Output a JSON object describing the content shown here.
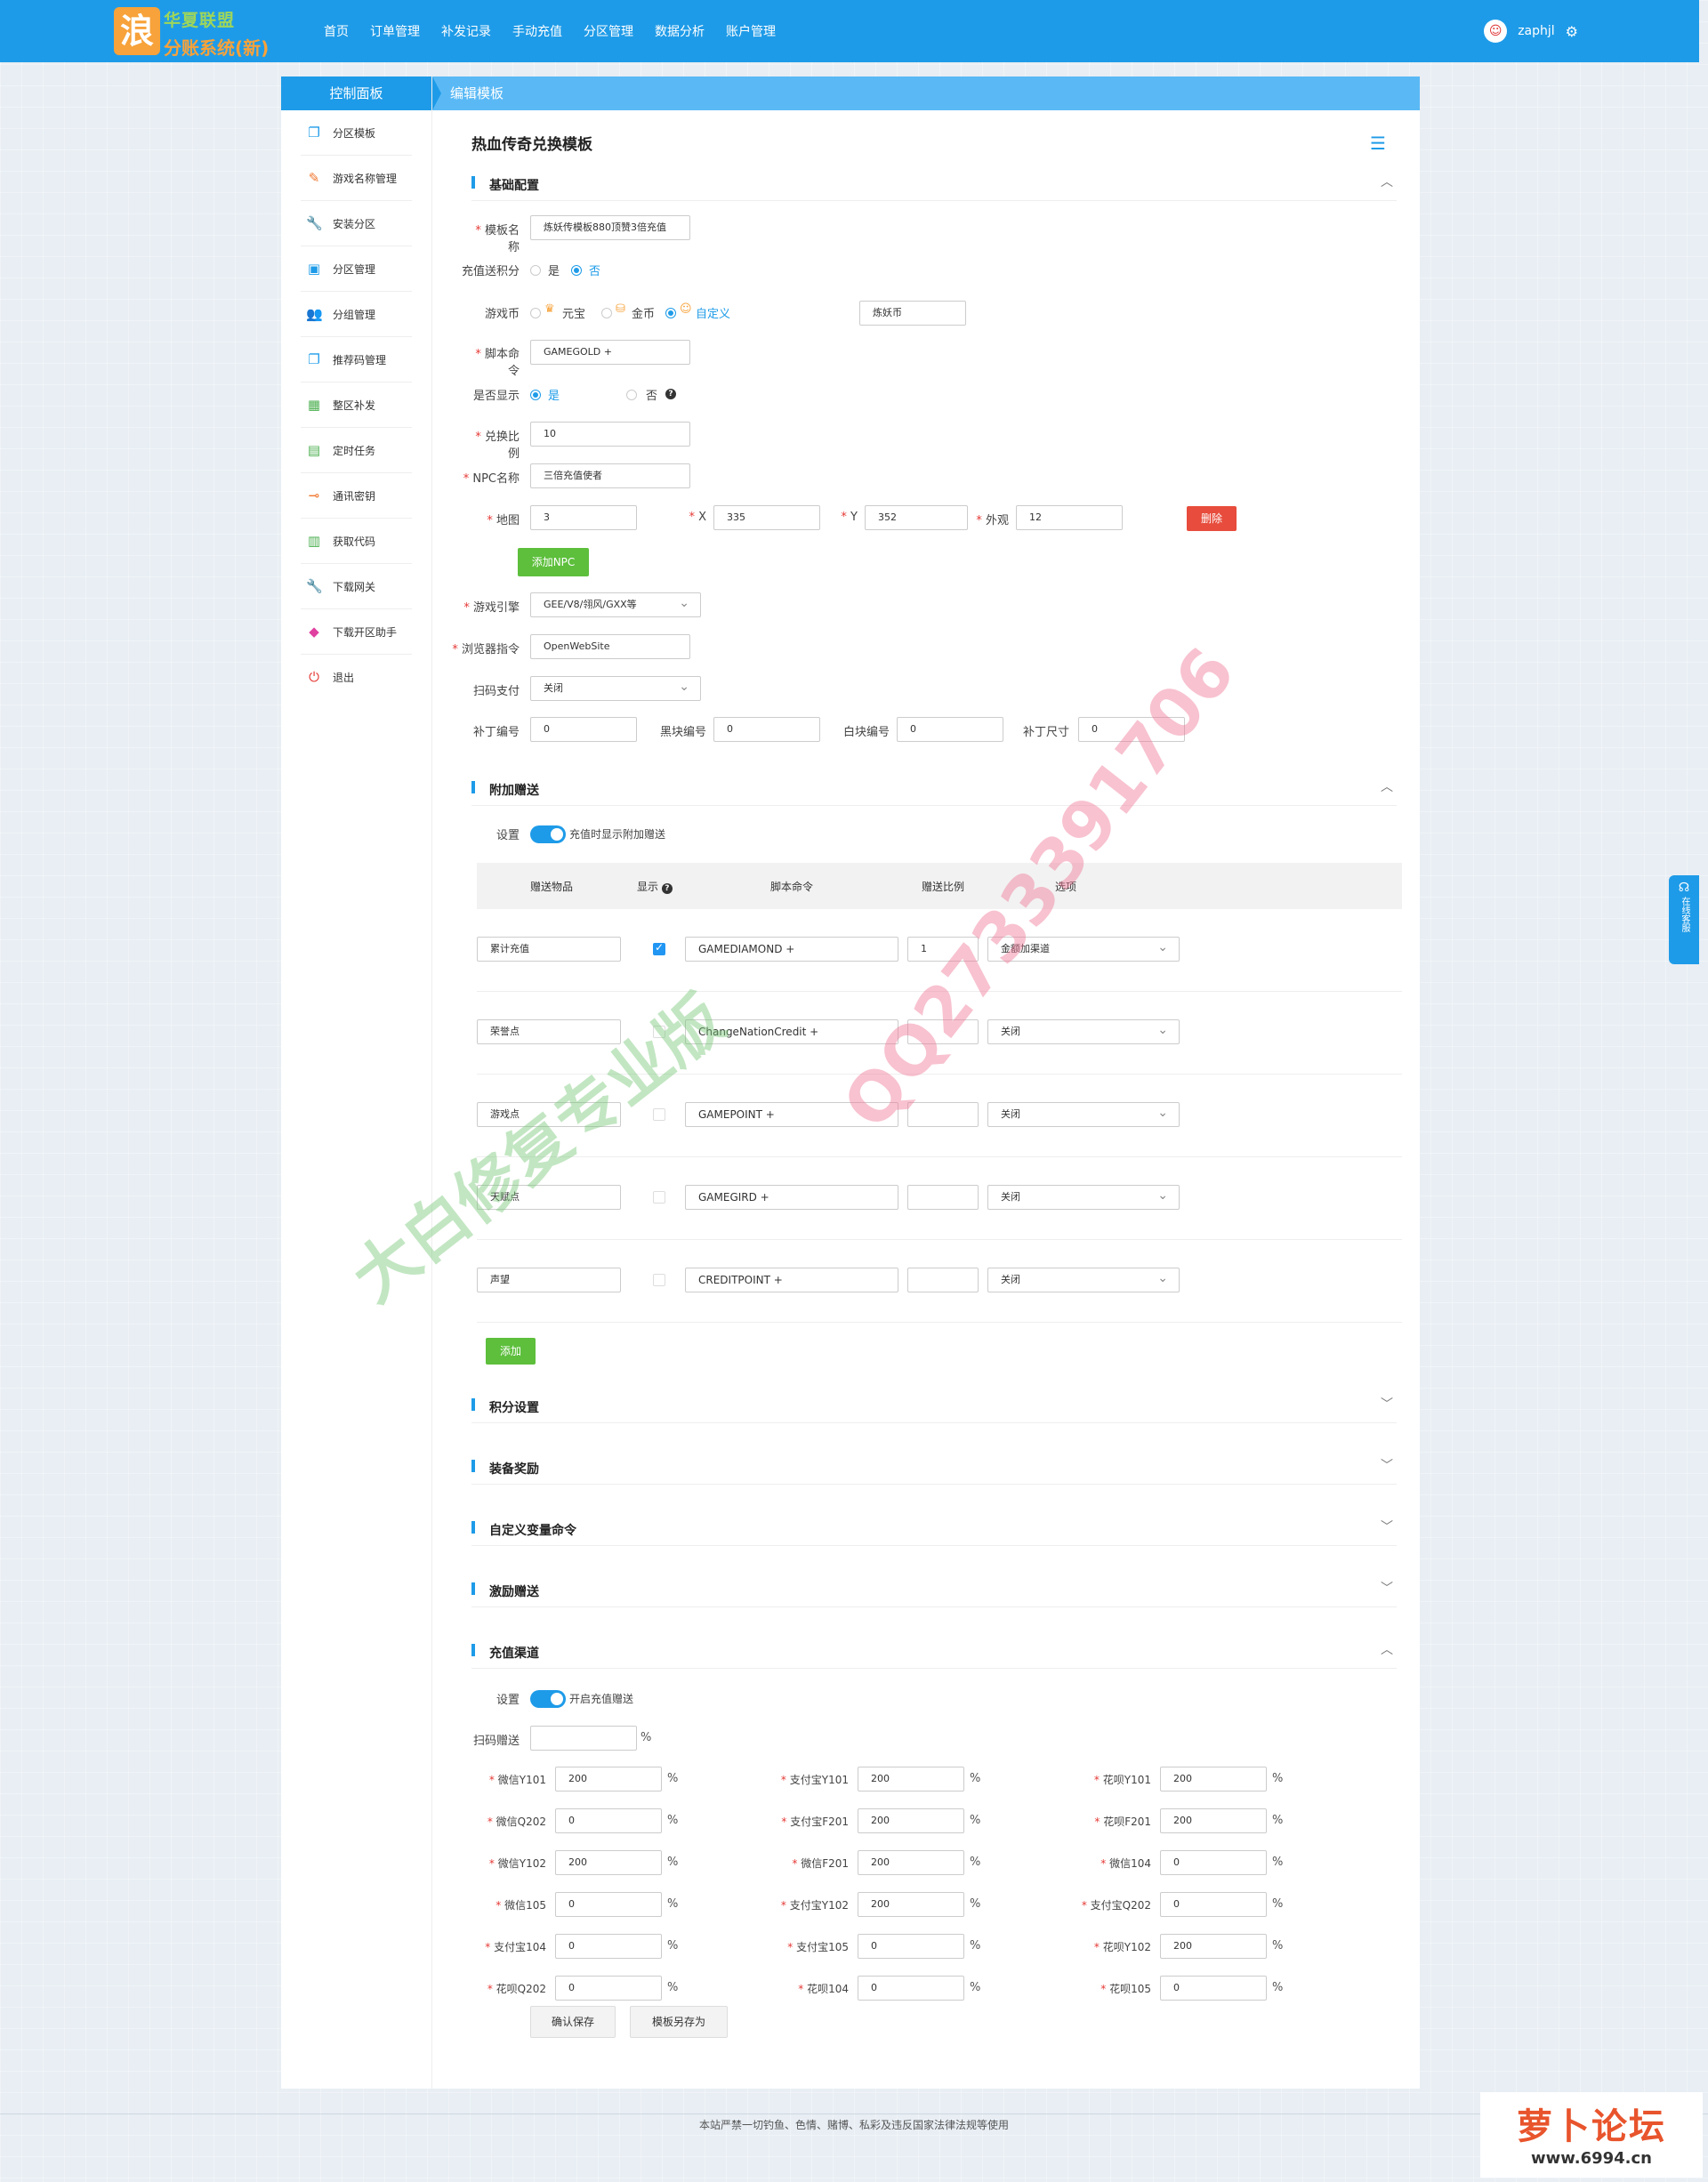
{
  "header": {
    "logo_glyph": "浪",
    "logo_sub": "华夏联盟",
    "logo_text": "分账系统(新)",
    "nav": [
      "首页",
      "订单管理",
      "补发记录",
      "手动充值",
      "分区管理",
      "数据分析",
      "账户管理"
    ],
    "username": "zaphjl"
  },
  "sidebar": {
    "title": "控制面板",
    "items": [
      {
        "label": "分区模板",
        "icon": "copy-icon"
      },
      {
        "label": "游戏名称管理",
        "icon": "pencil-icon"
      },
      {
        "label": "安装分区",
        "icon": "wrench-icon"
      },
      {
        "label": "分区管理",
        "icon": "inbox-icon"
      },
      {
        "label": "分组管理",
        "icon": "users-icon"
      },
      {
        "label": "推荐码管理",
        "icon": "copy-icon"
      },
      {
        "label": "整区补发",
        "icon": "suitcase-icon"
      },
      {
        "label": "定时任务",
        "icon": "calendar-icon"
      },
      {
        "label": "通讯密钥",
        "icon": "key-icon"
      },
      {
        "label": "获取代码",
        "icon": "briefcase-icon"
      },
      {
        "label": "下载网关",
        "icon": "wrench-icon"
      },
      {
        "label": "下载开区助手",
        "icon": "eraser-icon"
      },
      {
        "label": "退出",
        "icon": "power-icon"
      }
    ]
  },
  "breadcrumb": "编辑模板",
  "page_title": "热血传奇兑换模板",
  "basic": {
    "title": "基础配置",
    "template_name_label": "模板名称",
    "template_name": "炼妖传模板880顶赞3倍充值",
    "points_label": "充值送积分",
    "yes": "是",
    "no": "否",
    "currency_label": "游戏币",
    "currency_options": [
      "元宝",
      "金币",
      "自定义"
    ],
    "currency_custom": "炼妖币",
    "script_label": "脚本命令",
    "script": "GAMEGOLD +",
    "show_label": "是否显示",
    "ratio_label": "兑换比例",
    "ratio": "10",
    "npc_label": "NPC名称",
    "npc": "三倍充值使者",
    "map_label": "地图",
    "map": "3",
    "x_label": "X",
    "x": "335",
    "y_label": "Y",
    "y": "352",
    "look_label": "外观",
    "look": "12",
    "delete_btn": "删除",
    "add_npc_btn": "添加NPC",
    "engine_label": "游戏引擎",
    "engine": "GEE/V8/翎风/GXX等",
    "browser_label": "浏览器指令",
    "browser": "OpenWebSite",
    "scan_label": "扫码支付",
    "scan": "关闭",
    "patch_label": "补丁编号",
    "patch": "0",
    "black_label": "黑块编号",
    "black": "0",
    "white_label": "白块编号",
    "white": "0",
    "patch_size_label": "补丁尺寸",
    "patch_size": "0"
  },
  "bonus": {
    "title": "附加赠送",
    "setting_label": "设置",
    "toggle_text": "充值时显示附加赠送",
    "headers": [
      "赠送物品",
      "显示",
      "脚本命令",
      "赠送比例",
      "选项"
    ],
    "rows": [
      {
        "item": "累计充值",
        "checked": true,
        "script": "GAMEDIAMOND +",
        "ratio": "1",
        "option": "金额加渠道"
      },
      {
        "item": "荣誉点",
        "checked": false,
        "script": "ChangeNationCredit +",
        "ratio": "",
        "option": "关闭"
      },
      {
        "item": "游戏点",
        "checked": false,
        "script": "GAMEPOINT +",
        "ratio": "",
        "option": "关闭"
      },
      {
        "item": "天赋点",
        "checked": false,
        "script": "GAMEGIRD +",
        "ratio": "",
        "option": "关闭"
      },
      {
        "item": "声望",
        "checked": false,
        "script": "CREDITPOINT +",
        "ratio": "",
        "option": "关闭"
      }
    ],
    "add_btn": "添加"
  },
  "collapsed": [
    "积分设置",
    "装备奖励",
    "自定义变量命令",
    "激励赠送"
  ],
  "channel": {
    "title": "充值渠道",
    "setting_label": "设置",
    "toggle_text": "开启充值赠送",
    "scan_label": "扫码赠送",
    "scan_value": "",
    "pct": "%",
    "grid": [
      [
        {
          "label": "微信Y101",
          "value": "200"
        },
        {
          "label": "支付宝Y101",
          "value": "200"
        },
        {
          "label": "花呗Y101",
          "value": "200"
        }
      ],
      [
        {
          "label": "微信Q202",
          "value": "0"
        },
        {
          "label": "支付宝F201",
          "value": "200"
        },
        {
          "label": "花呗F201",
          "value": "200"
        }
      ],
      [
        {
          "label": "微信Y102",
          "value": "200"
        },
        {
          "label": "微信F201",
          "value": "200"
        },
        {
          "label": "微信104",
          "value": "0"
        }
      ],
      [
        {
          "label": "微信105",
          "value": "0"
        },
        {
          "label": "支付宝Y102",
          "value": "200"
        },
        {
          "label": "支付宝Q202",
          "value": "0"
        }
      ],
      [
        {
          "label": "支付宝104",
          "value": "0"
        },
        {
          "label": "支付宝105",
          "value": "0"
        },
        {
          "label": "花呗Y102",
          "value": "200"
        }
      ],
      [
        {
          "label": "花呗Q202",
          "value": "0"
        },
        {
          "label": "花呗104",
          "value": "0"
        },
        {
          "label": "花呗105",
          "value": "0"
        }
      ]
    ],
    "save_btn": "确认保存",
    "save_as_btn": "模板另存为"
  },
  "footer": "本站严禁一切钓鱼、色情、赌博、私彩及违反国家法律法规等使用",
  "chat_widget": "在线客服",
  "brand": {
    "title": "萝卜论坛",
    "url": "www.6994.cn"
  },
  "watermark": {
    "text_a": "大白修复专业版",
    "text_b": "QQ2733391706"
  }
}
